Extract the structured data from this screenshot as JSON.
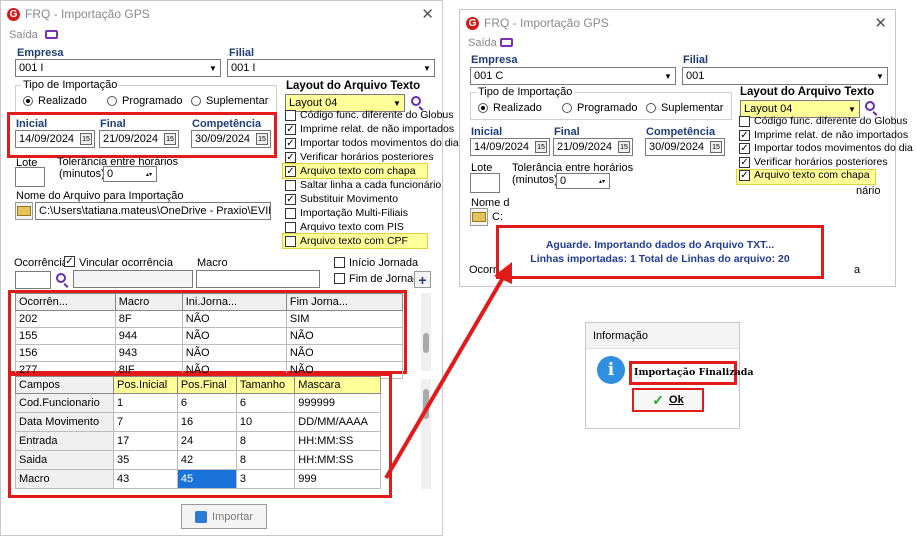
{
  "left_window": {
    "title": "FRQ - Importação GPS",
    "menu_saida": "Saída",
    "empresa_label": "Empresa",
    "empresa_value": "001 I",
    "filial_label": "Filial",
    "filial_value": "001 I",
    "tipo_label": "Tipo de Importação",
    "tipo_options": [
      "Realizado",
      "Programado",
      "Suplementar"
    ],
    "tipo_selected": "Realizado",
    "layout_label": "Layout do Arquivo Texto",
    "layout_value": "Layout 04",
    "inicial_label": "Inicial",
    "inicial_value": "14/09/2024",
    "final_label": "Final",
    "final_value": "21/09/2024",
    "competencia_label": "Competência",
    "competencia_value": "30/09/2024",
    "lote_label": "Lote",
    "tolerancia_label1": "Tolerância entre horários",
    "tolerancia_label2": "(minutos)",
    "tolerancia_value": "0",
    "nome_arquivo_label": "Nome do Arquivo para Importação",
    "arquivo_path": "C:\\Users\\tatiana.mateus\\OneDrive - Praxio\\EVIDENCIA",
    "options": [
      {
        "label": "Código func. diferente do Globus",
        "checked": false,
        "hl": false
      },
      {
        "label": "Imprime relat. de não importados",
        "checked": true,
        "hl": false
      },
      {
        "label": "Importar todos movimentos do dia",
        "checked": true,
        "hl": false
      },
      {
        "label": "Verificar horários posteriores",
        "checked": true,
        "hl": false
      },
      {
        "label": "Arquivo texto com chapa",
        "checked": true,
        "hl": true
      },
      {
        "label": "Saltar linha a cada funcionário",
        "checked": false,
        "hl": false
      },
      {
        "label": "Substituir Movimento",
        "checked": true,
        "hl": false
      },
      {
        "label": "Importação Multi-Filiais",
        "checked": false,
        "hl": false
      },
      {
        "label": "Arquivo texto com PIS",
        "checked": false,
        "hl": false
      },
      {
        "label": "Arquivo texto com CPF",
        "checked": false,
        "hl": true
      }
    ],
    "ocorrencia_label": "Ocorrência",
    "vincular_label": "Vincular ocorrência",
    "macro_label": "Macro",
    "inicio_jornada_label": "Início Jornada",
    "fim_jornada_label": "Fim de Jornada",
    "plus_label": "+",
    "ocorr_headers": [
      "Ocorrên...",
      "Macro",
      "Ini.Jorna...",
      "Fim Jorna..."
    ],
    "ocorr_rows": [
      [
        "202",
        "8F",
        "NÃO",
        "SIM"
      ],
      [
        "155",
        "944",
        "NÃO",
        "NÃO"
      ],
      [
        "156",
        "943",
        "NÃO",
        "NÃO"
      ],
      [
        "277",
        "8IF",
        "NÃO",
        "NÃO"
      ]
    ],
    "campos_headers": [
      "Campos",
      "Pos.Inicial",
      "Pos.Final",
      "Tamanho",
      "Mascara"
    ],
    "campos_rows": [
      [
        "Cod.Funcionario",
        "1",
        "6",
        "6",
        "999999"
      ],
      [
        "Data Movimento",
        "7",
        "16",
        "10",
        "DD/MM/AAAA"
      ],
      [
        "Entrada",
        "17",
        "24",
        "8",
        "HH:MM:SS"
      ],
      [
        "Saida",
        "35",
        "42",
        "8",
        "HH:MM:SS"
      ],
      [
        "Macro",
        "43",
        "45",
        "3",
        "999"
      ]
    ],
    "importar_label": "Importar"
  },
  "right_window": {
    "title": "FRQ - Importação GPS",
    "menu_saida": "Saída",
    "empresa_label": "Empresa",
    "empresa_value": "001 C",
    "filial_label": "Filial",
    "filial_value": "001",
    "tipo_label": "Tipo de Importação",
    "tipo_options": [
      "Realizado",
      "Programado",
      "Suplementar"
    ],
    "layout_label": "Layout do Arquivo Texto",
    "layout_value": "Layout 04",
    "inicial_label": "Inicial",
    "inicial_value": "14/09/2024",
    "final_label": "Final",
    "final_value": "21/09/2024",
    "competencia_label": "Competência",
    "competencia_value": "30/09/2024",
    "lote_label": "Lote",
    "tolerancia_label1": "Tolerância entre horários",
    "tolerancia_label2": "(minutos)",
    "tolerancia_value": "0",
    "nome_label": "Nome d",
    "path_stub": "C:",
    "func_tail": "nário",
    "ocorr_stub": "Ocorrê",
    "a_stub": "a",
    "options": [
      {
        "label": "Código func. diferente do Globus",
        "checked": false
      },
      {
        "label": "Imprime relat. de não importados",
        "checked": true
      },
      {
        "label": "Importar todos movimentos do dia",
        "checked": true
      },
      {
        "label": "Verificar horários posteriores",
        "checked": true
      },
      {
        "label": "Arquivo texto com chapa",
        "checked": true
      }
    ],
    "progress_line1": "Aguarde. Importando dados do Arquivo TXT...",
    "progress_line2": "Linhas importadas: 1 Total de Linhas do arquivo: 20"
  },
  "info_dialog": {
    "title": "Informação",
    "message": "Importação Finalizada",
    "ok_label": "Ok"
  },
  "colors": {
    "highlight_red": "#e21a1a",
    "label_blue": "#1f3c7a",
    "yellow_header": "#ffff99",
    "selected_cell": "#1a73d9"
  }
}
